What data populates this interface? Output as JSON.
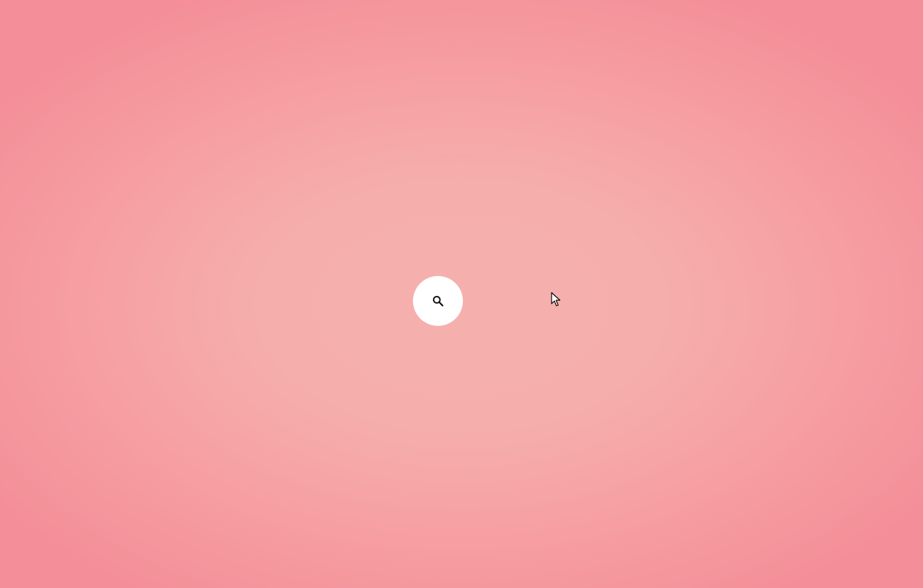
{
  "background": {
    "center_color": "#f5b0ad",
    "edge_color": "#f48e98"
  },
  "search": {
    "icon": "search-icon",
    "button_color": "#ffffff",
    "icon_color": "#111111"
  },
  "pointer": {
    "icon": "mouse-cursor-icon"
  }
}
